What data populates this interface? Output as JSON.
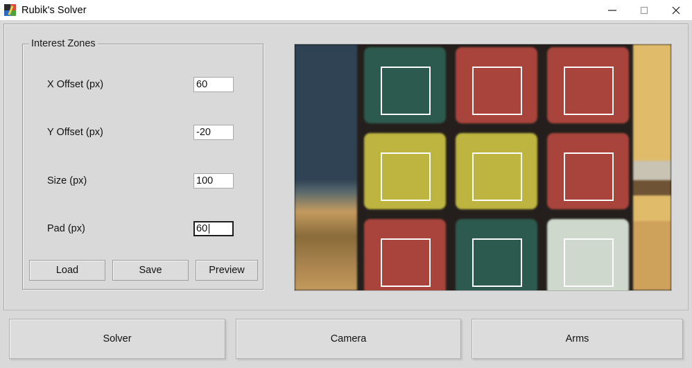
{
  "window": {
    "title": "Rubik's Solver",
    "icon": "rubiks-cube-icon",
    "controls": {
      "minimize": "—",
      "maximize": "□",
      "close": "✕"
    }
  },
  "interest_zones": {
    "legend": "Interest Zones",
    "fields": [
      {
        "label": "X Offset (px)",
        "value": "60",
        "focused": false
      },
      {
        "label": "Y Offset (px)",
        "value": "-20",
        "focused": false
      },
      {
        "label": "Size (px)",
        "value": "100",
        "focused": false
      },
      {
        "label": "Pad (px)",
        "value": "60",
        "focused": true
      }
    ],
    "buttons": [
      {
        "label": "Load"
      },
      {
        "label": "Save"
      },
      {
        "label": "Preview"
      }
    ]
  },
  "camera_preview": {
    "name": "camera-preview",
    "facelets": [
      [
        "green",
        "red",
        "red"
      ],
      [
        "yellow",
        "yellow",
        "red"
      ],
      [
        "red",
        "green",
        "white"
      ]
    ],
    "facelet_colors": {
      "green": "#2d5a4e",
      "red": "#a8443c",
      "yellow": "#bdb53f",
      "white": "#cfd8cc"
    },
    "gap_color": "#241f1c",
    "background": {
      "left_upper": "#2f4355",
      "left_lower": "#c49a5e",
      "right_wall": "#e0bc6a",
      "right_band": "#c9c3b4"
    },
    "zone_count": 9,
    "zone_border_color": "#ffffff"
  },
  "bottom_nav": {
    "buttons": [
      {
        "label": "Solver"
      },
      {
        "label": "Camera"
      },
      {
        "label": "Arms"
      }
    ]
  },
  "bottom_strip": {
    "text": "——— —— —— ——— — —— ———— —— — —— ——— —— ——— ——"
  }
}
